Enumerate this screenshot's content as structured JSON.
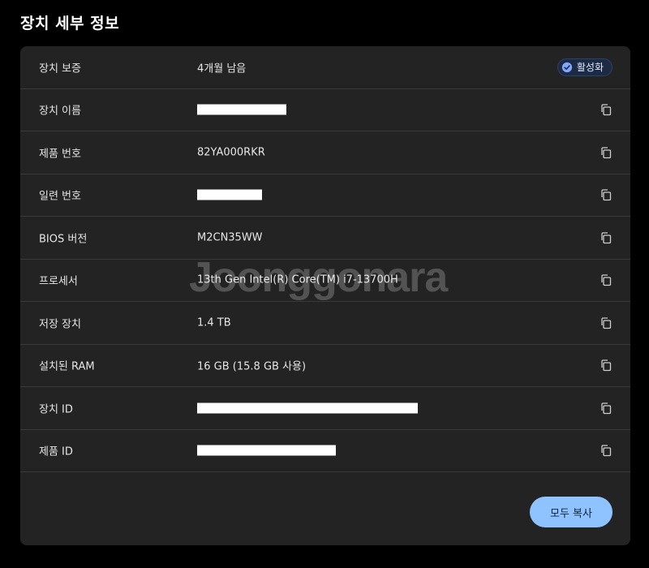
{
  "page": {
    "title": "장치 세부 정보"
  },
  "rows": [
    {
      "label": "장치 보증",
      "value": "4개월 남음",
      "badge": "활성화"
    },
    {
      "label": "장치 이름",
      "value": ""
    },
    {
      "label": "제품 번호",
      "value": "82YA000RKR"
    },
    {
      "label": "일련 번호",
      "value": ""
    },
    {
      "label": "BIOS 버전",
      "value": "M2CN35WW"
    },
    {
      "label": "프로세서",
      "value": "13th Gen Intel(R) Core(TM) i7-13700H"
    },
    {
      "label": "저장 장치",
      "value": "1.4 TB"
    },
    {
      "label": "설치된 RAM",
      "value": "16 GB (15.8 GB 사용)"
    },
    {
      "label": "장치 ID",
      "value": ""
    },
    {
      "label": "제품 ID",
      "value": ""
    }
  ],
  "actions": {
    "copy_all_label": "모두 복사"
  },
  "watermark": {
    "text": "Joonggonara"
  },
  "colors": {
    "background": "#000000",
    "panel": "#232323",
    "divider": "#3a3a3a",
    "accent_button": "#8ec3ff",
    "badge_bg": "#1d2a44",
    "badge_check": "#7fa8ff"
  },
  "icons": {
    "copy": "copy-icon",
    "check": "check-circle-icon"
  }
}
